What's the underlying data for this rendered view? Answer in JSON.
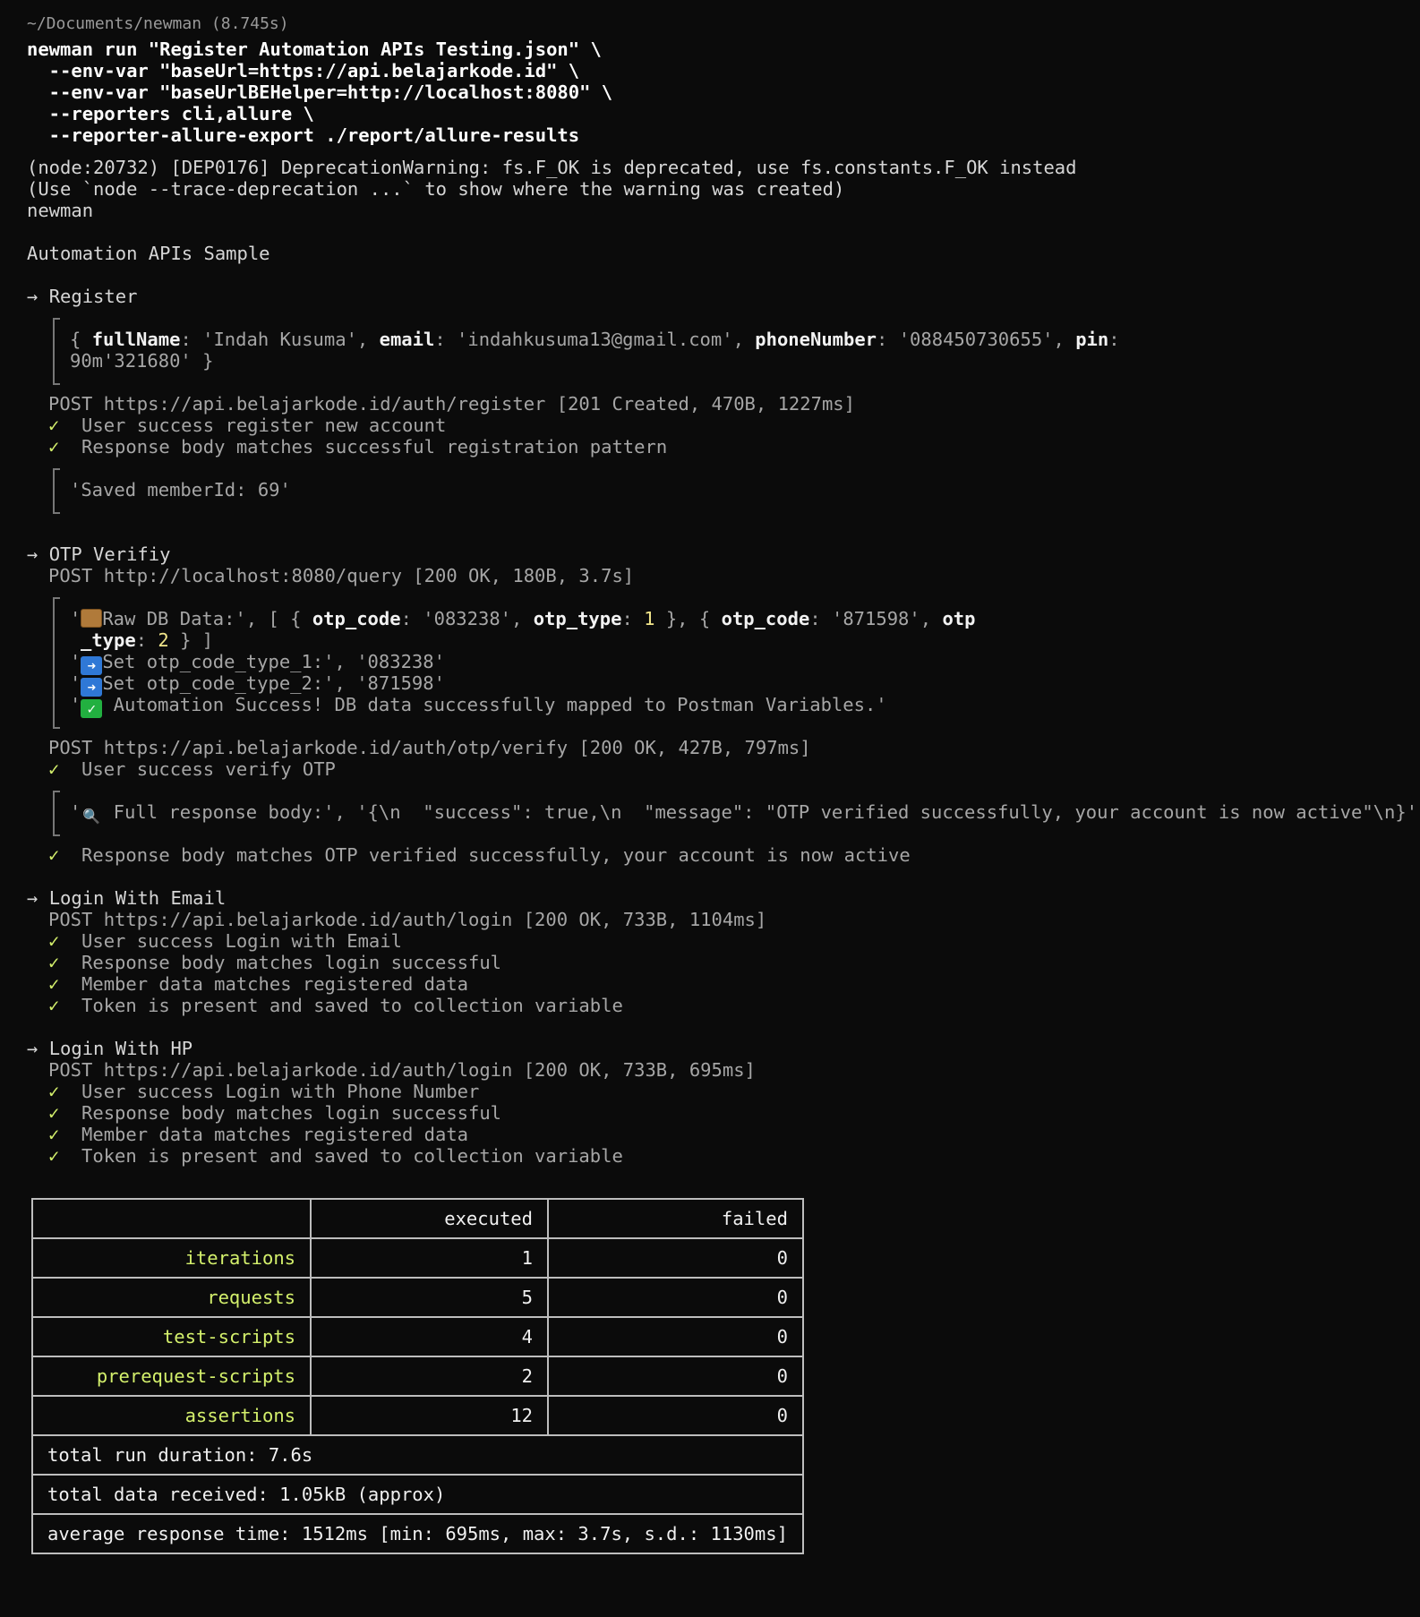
{
  "prompt_path": "~/Documents/newman (8.745s)",
  "command": [
    "newman run \"Register Automation APIs Testing.json\" \\",
    "  --env-var \"baseUrl=https://api.belajarkode.id\" \\",
    "  --env-var \"baseUrlBEHelper=http://localhost:8080\" \\",
    "  --reporters cli,allure \\",
    "  --reporter-allure-export ./report/allure-results"
  ],
  "warnings": [
    "(node:20732) [DEP0176] DeprecationWarning: fs.F_OK is deprecated, use fs.constants.F_OK instead",
    "(Use `node --trace-deprecation ...` to show where the warning was created)",
    "newman"
  ],
  "collection_name": "Automation APIs Sample",
  "arrow": "→",
  "check": "✓",
  "register": {
    "title": "Register",
    "log": {
      "fullName_key": "fullName",
      "fullName_val": "'Indah Kusuma'",
      "email_key": "email",
      "email_val": "'indahkusuma13@gmail.com'",
      "phone_key": "phoneNumber",
      "phone_val": "'088450730655'",
      "pin_key": "pin",
      "pin_val": "90m'321680'"
    },
    "request": "POST https://api.belajarkode.id/auth/register [201 Created, 470B, 1227ms]",
    "tests": [
      "User success register new account",
      "Response body matches successful registration pattern"
    ],
    "saved_log": "'Saved memberId: 69'"
  },
  "otp": {
    "title": "OTP Verifiy",
    "query_request": "POST http://localhost:8080/query [200 OK, 180B, 3.7s]",
    "raw_label": "Raw DB Data:', [ { ",
    "otp_code_key": "otp_code",
    "otp_code_val1": "'083238'",
    "otp_type_key": "otp_type",
    "otp_type_val1": "1",
    "otp_code_val2": "'871598'",
    "otp_type_key_wrap1": "otp",
    "otp_type_key_wrap2": "_type",
    "otp_type_val2": "2",
    "set1": "Set otp_code_type_1:', '083238'",
    "set2": "Set otp_code_type_2:', '871598'",
    "success_msg": " Automation Success! DB data successfully mapped to Postman Variables.'",
    "verify_request": "POST https://api.belajarkode.id/auth/otp/verify [200 OK, 427B, 797ms]",
    "test1": "User success verify OTP",
    "full_body": " Full response body:', '{\\n  \"success\": true,\\n  \"message\": \"OTP verified successfully, your account is now active\"\\n}'",
    "test2": "Response body matches OTP verified successfully, your account is now active"
  },
  "login_email": {
    "title": "Login With Email",
    "request": "POST https://api.belajarkode.id/auth/login [200 OK, 733B, 1104ms]",
    "tests": [
      "User success Login with Email",
      "Response body matches login successful",
      "Member data matches registered data",
      "Token is present and saved to collection variable"
    ]
  },
  "login_hp": {
    "title": "Login With HP",
    "request": "POST https://api.belajarkode.id/auth/login [200 OK, 733B, 695ms]",
    "tests": [
      "User success Login with Phone Number",
      "Response body matches login successful",
      "Member data matches registered data",
      "Token is present and saved to collection variable"
    ]
  },
  "summary": {
    "headers": [
      "",
      "executed",
      "failed"
    ],
    "rows": [
      {
        "label": "iterations",
        "executed": "1",
        "failed": "0"
      },
      {
        "label": "requests",
        "executed": "5",
        "failed": "0"
      },
      {
        "label": "test-scripts",
        "executed": "4",
        "failed": "0"
      },
      {
        "label": "prerequest-scripts",
        "executed": "2",
        "failed": "0"
      },
      {
        "label": "assertions",
        "executed": "12",
        "failed": "0"
      }
    ],
    "duration": "total run duration: 7.6s",
    "data_received": "total data received: 1.05kB (approx)",
    "avg_response": "average response time: 1512ms [min: 695ms, max: 3.7s, s.d.: 1130ms]"
  }
}
